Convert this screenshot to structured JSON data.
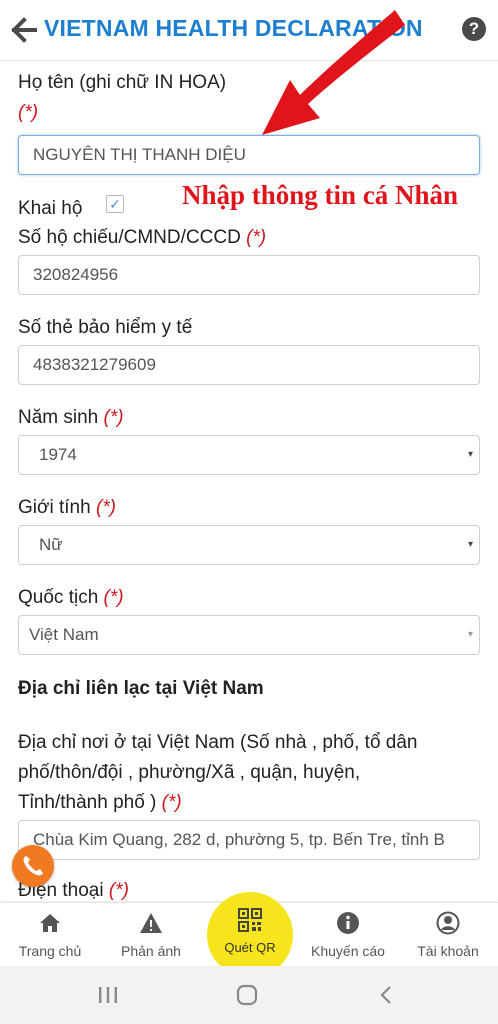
{
  "header": {
    "title": "VIETNAM HEALTH DECLARATION",
    "back_icon": "back-arrow-icon",
    "help_icon": "help-icon",
    "help_glyph": "?"
  },
  "form": {
    "fullname": {
      "label": "Họ tên (ghi chữ IN HOA)",
      "required": "(*)",
      "value": "NGUYÊN THỊ THANH DIỆU"
    },
    "on_behalf": {
      "label": "Khai hộ",
      "checked": true,
      "check_glyph": "✓"
    },
    "id_number": {
      "label": "Số hộ chiếu/CMND/CCCD",
      "required": "(*)",
      "value": "320824956"
    },
    "insurance": {
      "label": "Số thẻ bảo hiểm y tế",
      "value": "4838321279609"
    },
    "birth_year": {
      "label": "Năm sinh",
      "required": "(*)",
      "value": "1974"
    },
    "gender": {
      "label": "Giới tính",
      "required": "(*)",
      "value": "Nữ"
    },
    "nationality": {
      "label": "Quốc tịch",
      "required": "(*)",
      "value": "Việt Nam"
    },
    "contact_section": "Địa chỉ liên lạc tại Việt Nam",
    "address": {
      "label_line1": "Địa chỉ nơi ở tại Việt Nam (Số nhà , phố, tổ dân",
      "label_line2": "phố/thôn/đội , phường/Xã , quận, huyện,",
      "label_line3": "Tỉnh/thành phố )",
      "required": "(*)",
      "value": "Chùa Kim Quang, 282 d, phường 5, tp. Bến Tre, tỉnh B"
    },
    "phone": {
      "label": "Điện thoại",
      "required": "(*)"
    },
    "caret": "▾"
  },
  "annotation": {
    "text": "Nhập thông tin cá Nhân",
    "color": "#e0151c"
  },
  "bottom_nav": {
    "items": [
      {
        "label": "Trang chủ",
        "icon": "home-icon"
      },
      {
        "label": "Phản ánh",
        "icon": "warning-icon"
      },
      {
        "label": "Quét QR",
        "icon": "qr-code-icon"
      },
      {
        "label": "Khuyến cáo",
        "icon": "info-icon"
      },
      {
        "label": "Tài khoản",
        "icon": "account-icon"
      }
    ]
  },
  "system_nav": {
    "recents_icon": "recents-icon",
    "home_icon": "home-circle-icon",
    "back_icon": "system-back-icon"
  },
  "colors": {
    "brand_blue": "#1c7fd0",
    "required_red": "#d0161e",
    "qr_yellow": "#f6e51c",
    "phone_orange": "#f07a22"
  }
}
